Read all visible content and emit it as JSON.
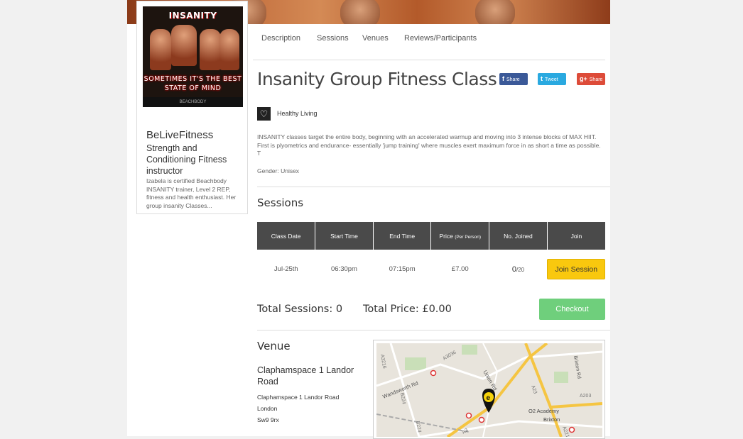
{
  "cover": {
    "brand": "INSANITY",
    "tagline_1": "SOMETIMES IT'S THE BEST",
    "tagline_2": "STATE OF MIND",
    "footer": "BEACHBODY"
  },
  "instructor": {
    "name": "BeLiveFitness",
    "title": "Strength and Conditioning Fitness instructor",
    "bio": "Izabela is certified Beachbody INSANITY trainer, Level 2 REP, fitness and health enthusiast. Her group insanity Classes..."
  },
  "tabs": [
    "Description",
    "Sessions",
    "Venues",
    "Reviews/Participants"
  ],
  "event": {
    "title": "Insanity Group Fitness Class",
    "category": "Healthy Living",
    "description": "INSANITY classes target the entire body, beginning with an accelerated warmup and moving into 3 intense blocks of MAX HIIT. First is plyometrics and endurance- essentially 'jump training' where muscles exert maximum force in as short a time as possible. T",
    "gender": "Gender: Unisex"
  },
  "share": {
    "facebook": "Share",
    "twitter": "Tweet",
    "google": "Share",
    "facebook_icon": "f",
    "twitter_icon": "t",
    "google_icon": "g+"
  },
  "sessions": {
    "heading": "Sessions",
    "columns": [
      "Class Date",
      "Start Time",
      "End Time",
      "Price",
      "No. Joined",
      "Join"
    ],
    "price_note": "(Per Person)",
    "rows": [
      {
        "date": "Jul-25th",
        "start": "06:30pm",
        "end": "07:15pm",
        "price": "£7.00",
        "joined": "0",
        "capacity": "/20",
        "join_label": "Join Session"
      }
    ]
  },
  "totals": {
    "sessions": "Total Sessions: 0",
    "price": "Total Price: £0.00",
    "checkout": "Checkout"
  },
  "venue": {
    "heading": "Venue",
    "name": "Claphamspace 1 Landor Road",
    "address_1": "Claphamspace 1 Landor Road",
    "address_2": "London",
    "postcode": "Sw9 9rx"
  },
  "map": {
    "labels": {
      "a3216": "A3216",
      "a3036": "A3036",
      "wandsworth": "Wandsworth Rd",
      "union": "Union Rd",
      "b224": "B224",
      "b224b": "B224",
      "a23": "A23",
      "a3": "A3",
      "a203": "A203",
      "a2217": "A2217",
      "brixton_rd": "Brixton Rd",
      "o2": "O2 Academy",
      "brixton": "Brixton"
    }
  },
  "colors": {
    "checkout": "#6fcf7c",
    "join": "#f9c80e",
    "facebook": "#3b5998",
    "twitter": "#2aa9e0",
    "google": "#dd4b39",
    "table_header": "#4a4a4a"
  }
}
